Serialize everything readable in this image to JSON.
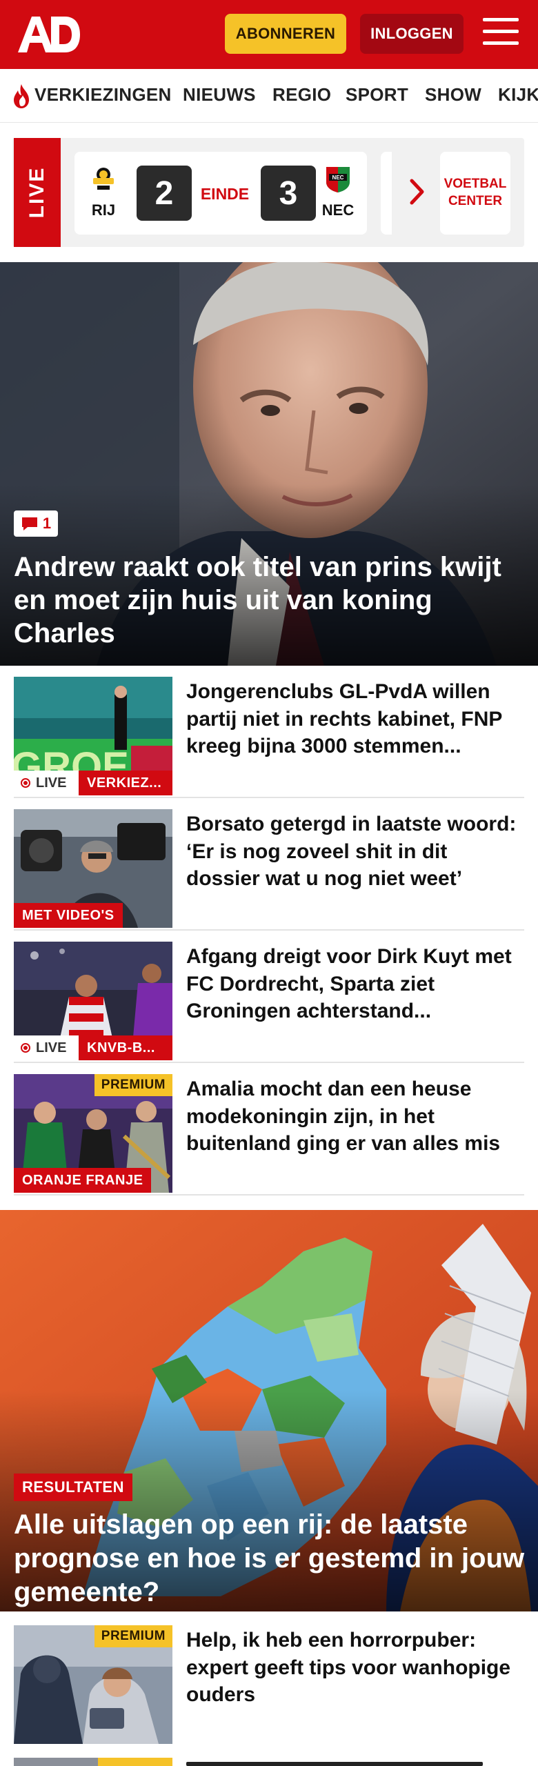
{
  "header": {
    "subscribe_label": "ABONNEREN",
    "login_label": "INLOGGEN",
    "brand_color": "#d10a11",
    "subscribe_color": "#f5c228"
  },
  "nav": {
    "items": [
      "VERKIEZINGEN",
      "NIEUWS",
      "REGIO",
      "SPORT",
      "SHOW",
      "KIJK"
    ]
  },
  "live": {
    "label": "LIVE",
    "home_team": "RIJ",
    "home_score": "2",
    "status": "EINDE",
    "away_score": "3",
    "away_team": "NEC",
    "center_label": "VOETBAL CENTER"
  },
  "hero": {
    "comment_count": "1",
    "title": "Andrew raakt ook titel van prins kwijt en moet zijn huis uit van koning Charles"
  },
  "articles": [
    {
      "title": "Jongerenclubs GL-PvdA willen partij niet in rechts kabinet, FNP kreeg bijna 3000 stemmen...",
      "live": "LIVE",
      "tag": "VERKIEZ..."
    },
    {
      "title": "Borsato getergd in laatste woord: ‘Er is nog zoveel shit in dit dossier wat u nog niet weet’",
      "tag": "MET VIDEO'S"
    },
    {
      "title": "Afgang dreigt voor Dirk Kuyt met FC Dordrecht, Sparta ziet Groningen achterstand...",
      "live": "LIVE",
      "tag": "KNVB-B..."
    },
    {
      "title": "Amalia mocht dan een heuse modekoningin zijn, in het buitenland ging er van alles mis",
      "premium": "PREMIUM",
      "tag": "ORANJE FRANJE"
    }
  ],
  "results": {
    "tag": "RESULTATEN",
    "title": "Alle uitslagen op een rij: de laatste prognose en hoe is er gestemd in jouw gemeente?"
  },
  "article_after": {
    "title": "Help, ik heb een horrorpuber: expert geeft tips voor wanhopige ouders",
    "premium": "PREMIUM"
  }
}
